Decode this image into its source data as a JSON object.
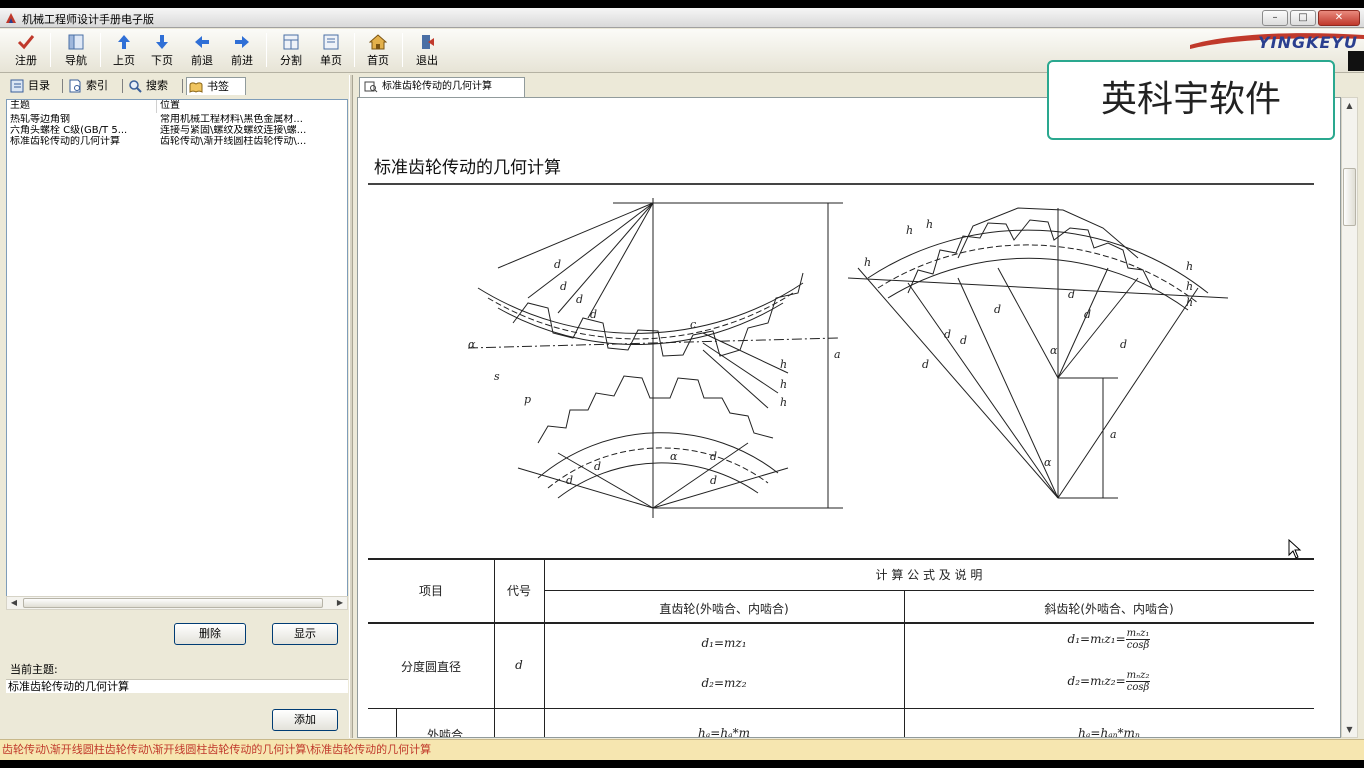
{
  "window": {
    "title": "机械工程师设计手册电子版"
  },
  "toolbar": {
    "items": [
      {
        "label": "注册"
      },
      {
        "label": "导航"
      },
      {
        "label": "上页"
      },
      {
        "label": "下页"
      },
      {
        "label": "前退"
      },
      {
        "label": "前进"
      },
      {
        "label": "分割"
      },
      {
        "label": "单页"
      },
      {
        "label": "首页"
      },
      {
        "label": "退出"
      }
    ],
    "brand": "YINGKEYU"
  },
  "left_tabs": [
    {
      "label": "目录"
    },
    {
      "label": "索引"
    },
    {
      "label": "搜索"
    },
    {
      "label": "书签"
    }
  ],
  "bookmark_list": {
    "columns": [
      "主题",
      "位置"
    ],
    "rows": [
      {
        "topic": "热轧等边角钢",
        "location": "常用机械工程材料\\黑色金属材..."
      },
      {
        "topic": "六角头螺栓 C级(GB/T 5...",
        "location": "连接与紧固\\螺纹及螺纹连接\\螺..."
      },
      {
        "topic": "标准齿轮传动的几何计算",
        "location": "齿轮传动\\渐开线圆柱齿轮传动\\..."
      }
    ]
  },
  "buttons": {
    "delete": "删除",
    "show": "显示",
    "add": "添加"
  },
  "current_topic": {
    "label": "当前主题:",
    "value": "标准齿轮传动的几何计算"
  },
  "doc": {
    "tab_label": "标准齿轮传动的几何计算",
    "title": "标准齿轮传动的几何计算",
    "table": {
      "header_item": "项目",
      "header_code": "代号",
      "header_formula": "计 算 公 式 及 说 明",
      "header_spur": "直齿轮(外啮合、内啮合)",
      "header_helical": "斜齿轮(外啮合、内啮合)",
      "row1_item": "分度圆直径",
      "row1_code": "d",
      "row1_spur1": "d₁=mz₁",
      "row1_spur2": "d₂=mz₂",
      "row1_helical1_lhs": "d₁=mₜz₁=",
      "row1_helical1_num": "mₙz₁",
      "row1_helical1_den": "cosβ",
      "row1_helical2_lhs": "d₂=mₜz₂=",
      "row1_helical2_num": "mₙz₂",
      "row1_helical2_den": "cosβ",
      "row2_item": "外啮合",
      "row2_spur": "hₐ=hₐ*m",
      "row2_helical": "hₐ=hₐₙ*mₙ"
    }
  },
  "watermark": "英科宇软件",
  "status": "齿轮传动\\渐开线圆柱齿轮传动\\渐开线圆柱齿轮传动的几何计算\\标准齿轮传动的几何计算"
}
